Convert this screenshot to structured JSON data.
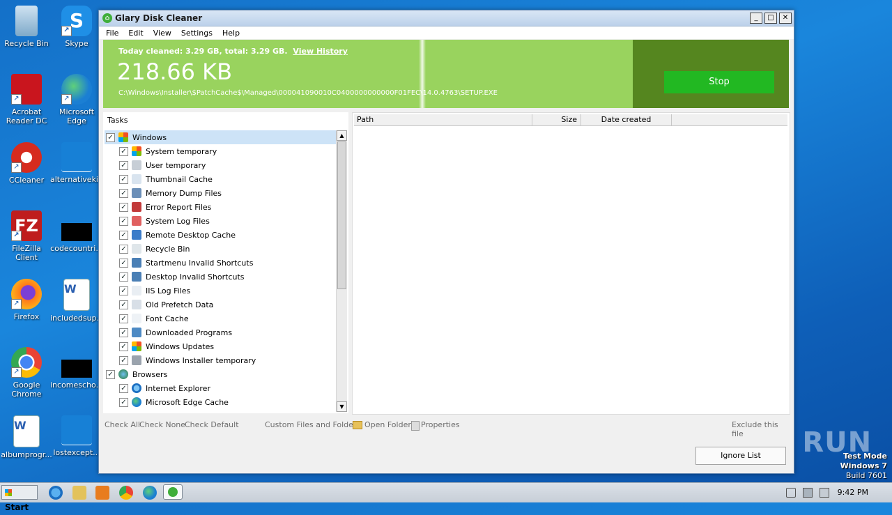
{
  "desktop": {
    "icons": [
      {
        "label": "Recycle Bin"
      },
      {
        "label": "Skype"
      },
      {
        "label": "Acrobat Reader DC"
      },
      {
        "label": "Microsoft Edge"
      },
      {
        "label": "CCleaner"
      },
      {
        "label": "alternativeki..."
      },
      {
        "label": "FileZilla Client"
      },
      {
        "label": "codecountri..."
      },
      {
        "label": "Firefox"
      },
      {
        "label": "includedsup..."
      },
      {
        "label": "Google Chrome"
      },
      {
        "label": "incomescho..."
      },
      {
        "label": "albumprogr..."
      },
      {
        "label": "lostexcept..."
      }
    ]
  },
  "window": {
    "title": "Glary Disk Cleaner",
    "minimize": "_",
    "maximize": "□",
    "close": "✕"
  },
  "menu": [
    "File",
    "Edit",
    "View",
    "Settings",
    "Help"
  ],
  "banner": {
    "summary": "Today cleaned: 3.29 GB, total: 3.29 GB.",
    "history_link": "View History",
    "size": "218.66 KB",
    "path": "C:\\Windows\\Installer\\$PatchCache$\\Managed\\000041090010C0400000000000F01FEC\\14.0.4763\\SETUP.EXE",
    "stop": "Stop",
    "accent": "#99d35e",
    "dark": "#55861f",
    "button_color": "#22b822"
  },
  "tasks": {
    "header": "Tasks",
    "items": [
      {
        "label": "Windows",
        "level": 1,
        "checked": true,
        "selected": true,
        "icon": "windows-flag-icon"
      },
      {
        "label": "System temporary",
        "level": 2,
        "checked": true,
        "icon": "windows-flag-icon"
      },
      {
        "label": "User temporary",
        "level": 2,
        "checked": true,
        "icon": "user-file-icon"
      },
      {
        "label": "Thumbnail Cache",
        "level": 2,
        "checked": true,
        "icon": "thumbnail-icon"
      },
      {
        "label": "Memory Dump Files",
        "level": 2,
        "checked": true,
        "icon": "memory-icon"
      },
      {
        "label": "Error Report Files",
        "level": 2,
        "checked": true,
        "icon": "error-report-icon"
      },
      {
        "label": "System Log Files",
        "level": 2,
        "checked": true,
        "icon": "log-icon"
      },
      {
        "label": "Remote Desktop Cache",
        "level": 2,
        "checked": true,
        "icon": "remote-desktop-icon"
      },
      {
        "label": "Recycle Bin",
        "level": 2,
        "checked": true,
        "icon": "recycle-bin-icon"
      },
      {
        "label": "Startmenu Invalid Shortcuts",
        "level": 2,
        "checked": true,
        "icon": "shortcut-icon"
      },
      {
        "label": "Desktop Invalid Shortcuts",
        "level": 2,
        "checked": true,
        "icon": "shortcut-icon"
      },
      {
        "label": "IIS Log Files",
        "level": 2,
        "checked": true,
        "icon": "document-icon"
      },
      {
        "label": "Old Prefetch Data",
        "level": 2,
        "checked": true,
        "icon": "clock-icon"
      },
      {
        "label": "Font Cache",
        "level": 2,
        "checked": true,
        "icon": "font-icon"
      },
      {
        "label": "Downloaded Programs",
        "level": 2,
        "checked": true,
        "icon": "download-icon"
      },
      {
        "label": "Windows Updates",
        "level": 2,
        "checked": true,
        "icon": "windows-flag-icon"
      },
      {
        "label": "Windows Installer temporary",
        "level": 2,
        "checked": true,
        "icon": "installer-icon"
      },
      {
        "label": "Browsers",
        "level": 1,
        "checked": true,
        "icon": "globe-icon"
      },
      {
        "label": "Internet Explorer",
        "level": 2,
        "checked": true,
        "icon": "ie-icon"
      },
      {
        "label": "Microsoft Edge Cache",
        "level": 2,
        "checked": true,
        "icon": "edge-icon"
      }
    ]
  },
  "results": {
    "columns": [
      "Path",
      "Size",
      "Date created"
    ]
  },
  "links": {
    "check_all": "Check All",
    "check_none": "Check None",
    "check_default": "Check Default",
    "custom": "Custom Files and Folders",
    "open_folder": "Open Folder",
    "properties": "Properties",
    "exclude": "Exclude this file"
  },
  "ignore_list": "Ignore List",
  "taskbar": {
    "start": "Start",
    "clock": "9:42 PM"
  },
  "watermark": "ANY RUN",
  "testmode": {
    "line1": "Test Mode",
    "line2": "Windows 7",
    "line3": "Build 7601"
  }
}
